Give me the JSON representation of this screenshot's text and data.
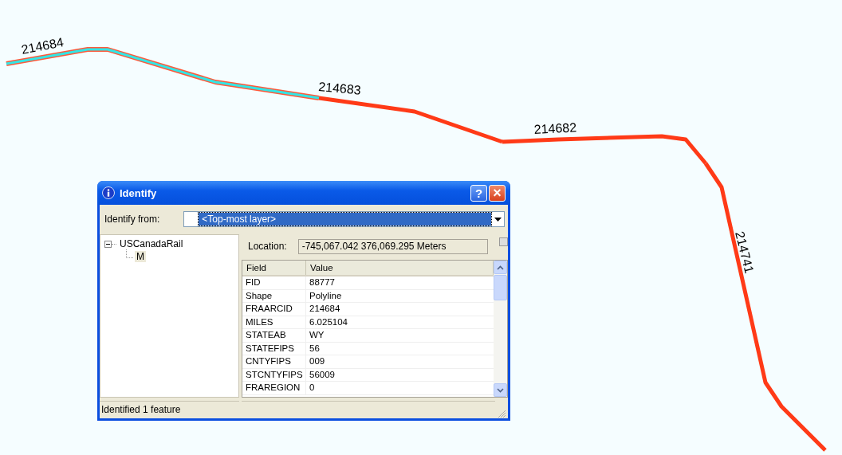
{
  "map": {
    "segments": [
      {
        "label": "214684",
        "selected": true
      },
      {
        "label": "214683",
        "selected": false
      },
      {
        "label": "214682",
        "selected": false
      },
      {
        "label": "214741",
        "selected": false
      }
    ]
  },
  "dialog": {
    "title": "Identify",
    "help_button": "?",
    "close_button": "×",
    "identify_from": {
      "label": "Identify from:",
      "value": "<Top-most layer>"
    },
    "tree": [
      {
        "label": "USCanadaRail",
        "expanded": true,
        "children": [
          {
            "label": "M",
            "selected": true
          }
        ]
      }
    ],
    "location": {
      "label": "Location:",
      "value": "-745,067.042  376,069.295 Meters"
    },
    "table": {
      "columns": [
        "Field",
        "Value"
      ],
      "rows": [
        [
          "FID",
          "88777"
        ],
        [
          "Shape",
          "Polyline"
        ],
        [
          "FRAARCID",
          "214684"
        ],
        [
          "MILES",
          "6.025104"
        ],
        [
          "STATEAB",
          "WY"
        ],
        [
          "STATEFIPS",
          "56"
        ],
        [
          "CNTYFIPS",
          "009"
        ],
        [
          "STCNTYFIPS",
          "56009"
        ],
        [
          "FRAREGION",
          "0"
        ]
      ]
    },
    "status": "Identified 1 feature"
  }
}
